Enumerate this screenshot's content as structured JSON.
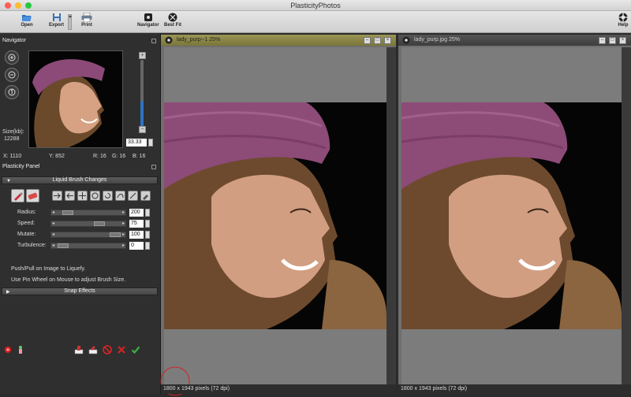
{
  "window": {
    "title": "PlasticityPhotos"
  },
  "toolbar": {
    "open": "Open",
    "export": "Export",
    "print": "Print",
    "navigator": "Navigator",
    "best_fit": "Best Fit",
    "help": "Help"
  },
  "navigator": {
    "title": "Navigator",
    "zoom": "33.33",
    "size_label": "Size(kb):",
    "size_value": "12288",
    "x": "X: 1110",
    "y": "Y: 852",
    "r": "R: 16",
    "g": "G: 16",
    "b": "B: 16"
  },
  "plasticity": {
    "title": "Plasticity Panel",
    "liquid_section": "Liquid Brush Changes",
    "sliders": [
      {
        "label": "Radius:",
        "value": "200",
        "position": 0.18
      },
      {
        "label": "Speed:",
        "value": "75",
        "position": 0.6
      },
      {
        "label": "Mutate:",
        "value": "100",
        "position": 0.88
      },
      {
        "label": "Turbulence:",
        "value": "0",
        "position": 0.0
      }
    ],
    "hint1": "Push/Pull on Image to Liquefy.",
    "hint2": "Use Pin Wheel on Mouse to adjust Brush Size.",
    "snap_section": "Snap Effects"
  },
  "documents": [
    {
      "title": "lady_purp--1 25%",
      "status": "1800 x 1943 pixels (72 dpi)"
    },
    {
      "title": "lady_purp.jpg 25%",
      "status": "1800 x 1943 pixels (72 dpi)"
    }
  ],
  "colors": {
    "accent_tab": "#8a8440",
    "ok": "#3cb043",
    "cancel": "#d02424"
  }
}
